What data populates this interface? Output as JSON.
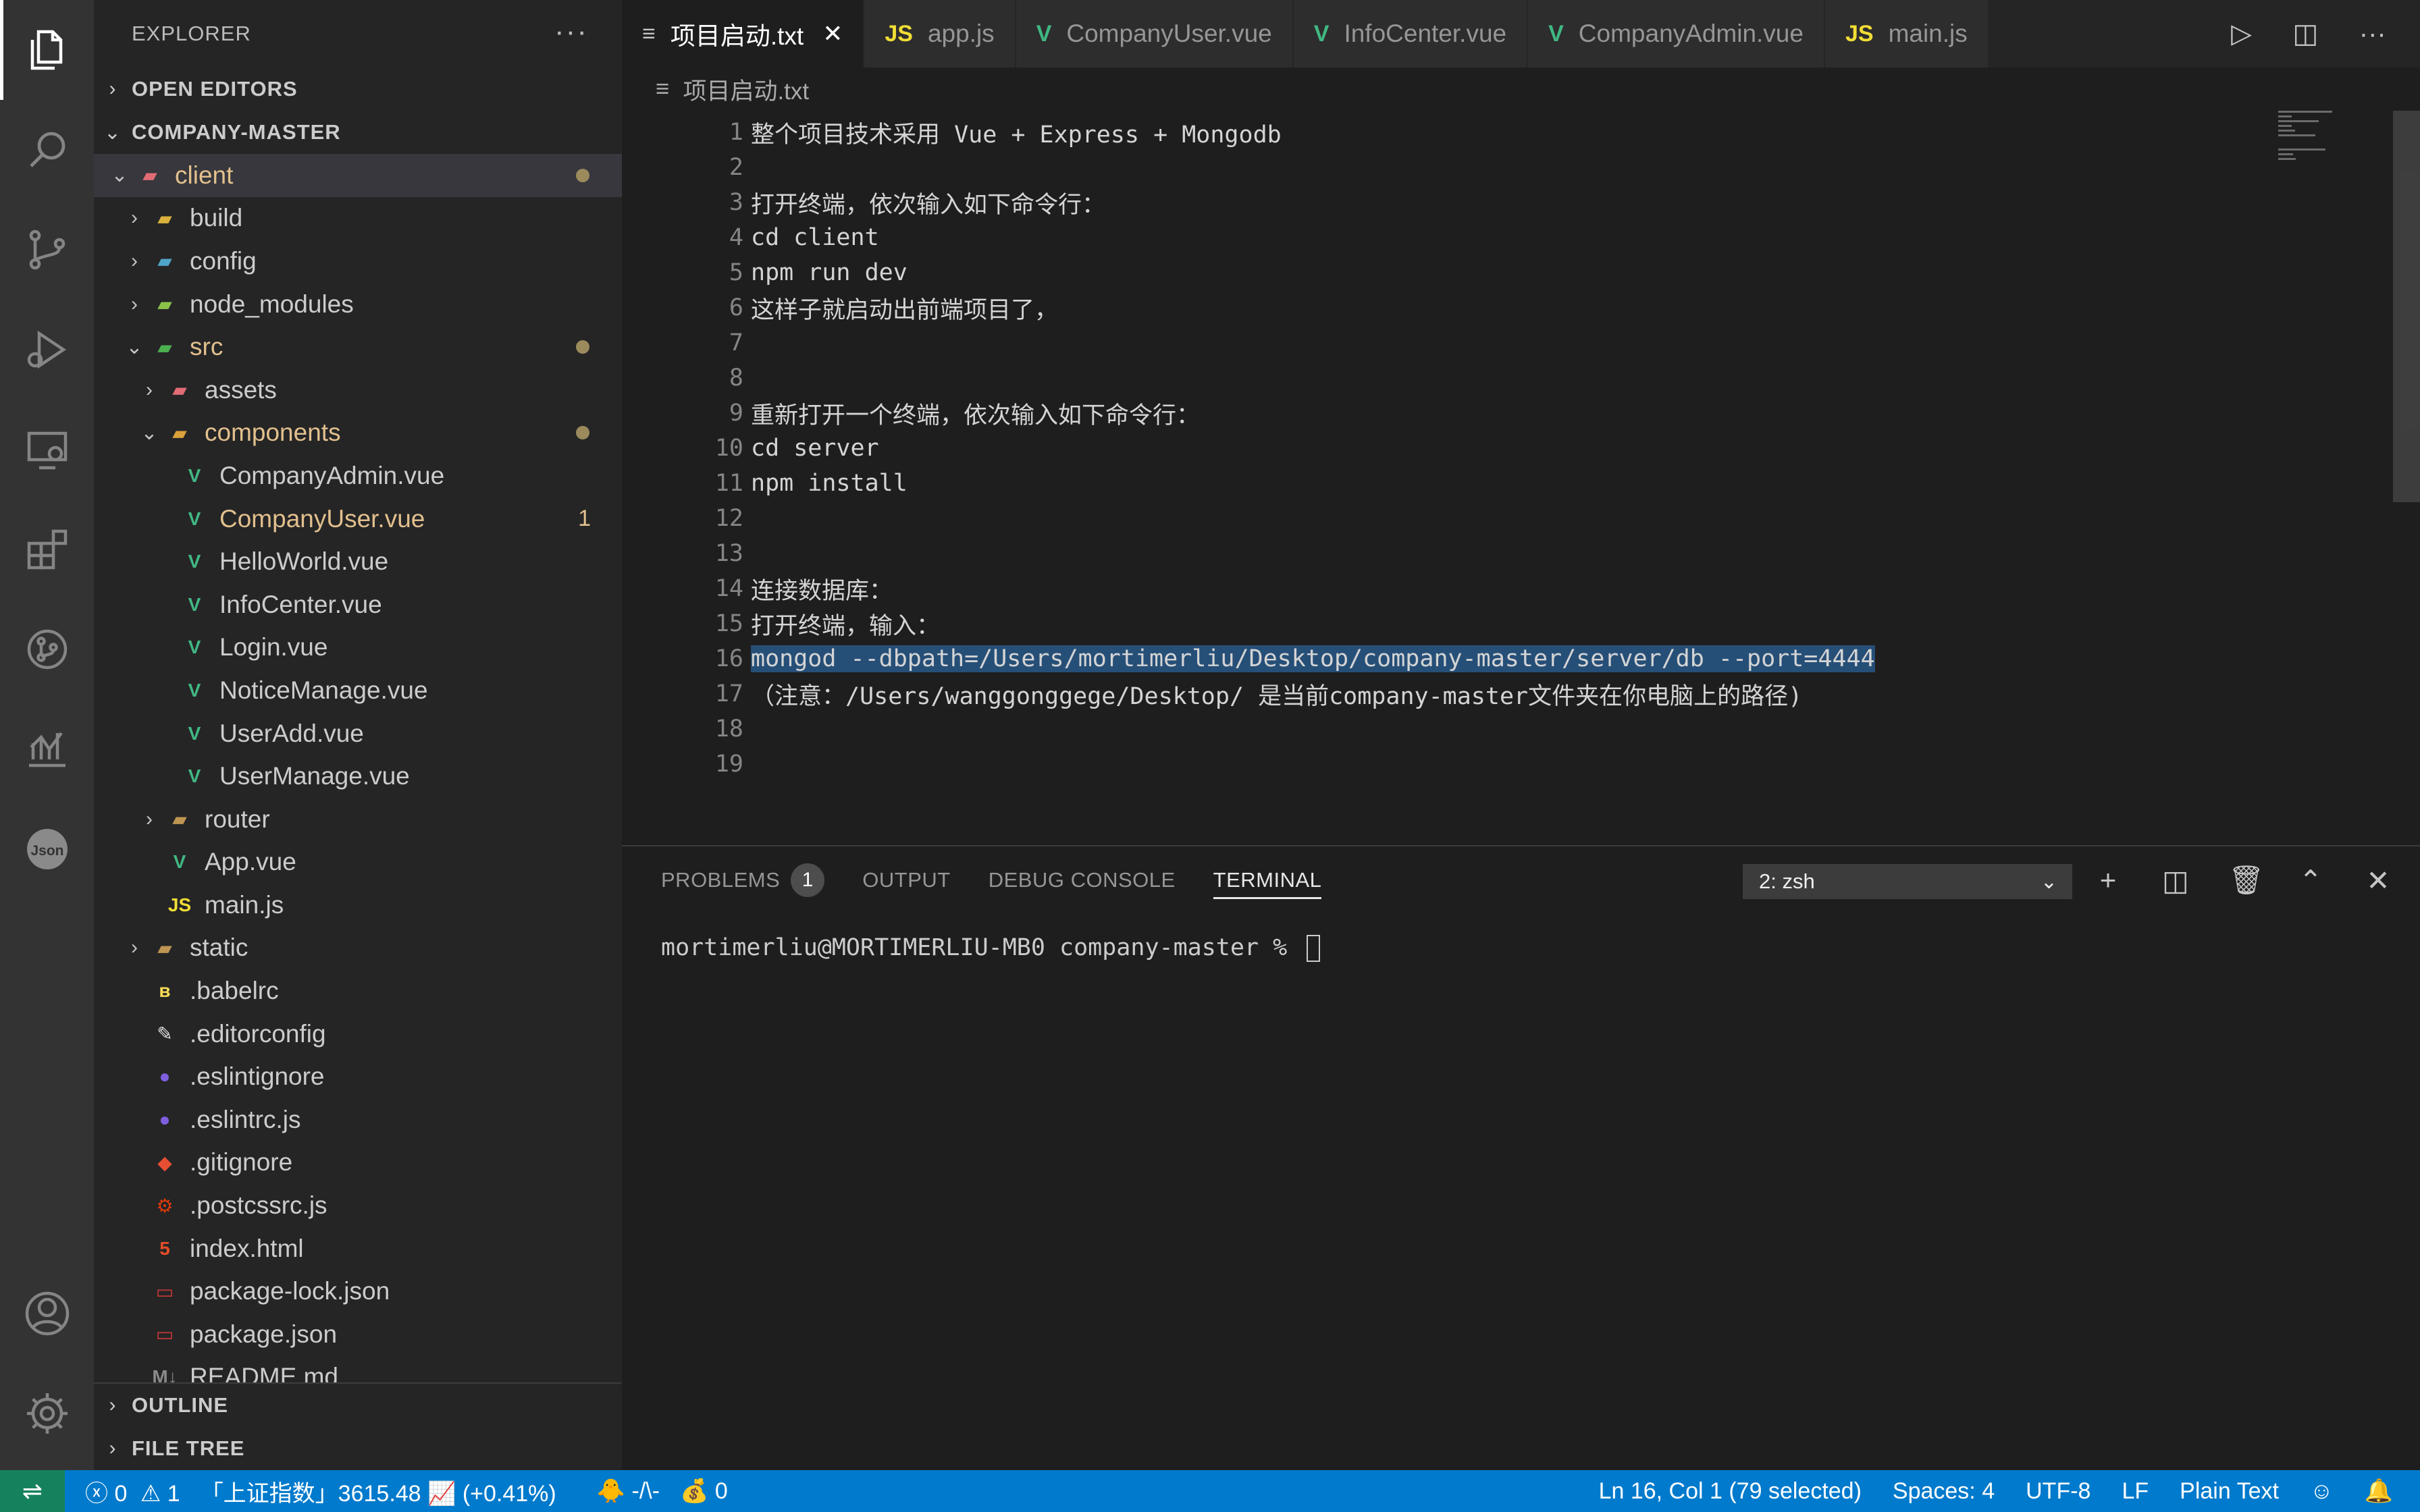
{
  "tabs": [
    {
      "label": "项目启动.txt",
      "icon": "≡",
      "active": true
    },
    {
      "label": "app.js",
      "icon": "JS"
    },
    {
      "label": "CompanyUser.vue",
      "icon": "V"
    },
    {
      "label": "InfoCenter.vue",
      "icon": "V"
    },
    {
      "label": "CompanyAdmin.vue",
      "icon": "V"
    },
    {
      "label": "main.js",
      "icon": "JS"
    }
  ],
  "sidebar": {
    "title": "EXPLORER",
    "open_editors": "OPEN EDITORS",
    "project": "COMPANY-MASTER",
    "outline": "OUTLINE",
    "file_tree": "FILE TREE",
    "items": [
      {
        "label": "client",
        "depth": 0,
        "arrow": "⌄",
        "icon": "folder-vue",
        "modified": true,
        "dot": true,
        "selected": true
      },
      {
        "label": "build",
        "depth": 1,
        "arrow": "›",
        "icon": "folder-build"
      },
      {
        "label": "config",
        "depth": 1,
        "arrow": "›",
        "icon": "folder-config"
      },
      {
        "label": "node_modules",
        "depth": 1,
        "arrow": "›",
        "icon": "folder-node"
      },
      {
        "label": "src",
        "depth": 1,
        "arrow": "⌄",
        "icon": "folder-src",
        "modified": true,
        "dot": true
      },
      {
        "label": "assets",
        "depth": 2,
        "arrow": "›",
        "icon": "folder-assets"
      },
      {
        "label": "components",
        "depth": 2,
        "arrow": "⌄",
        "icon": "folder-components",
        "modified": true,
        "dot": true
      },
      {
        "label": "CompanyAdmin.vue",
        "depth": 3,
        "icon": "vue"
      },
      {
        "label": "CompanyUser.vue",
        "depth": 3,
        "icon": "vue",
        "modified": true,
        "badge": "1"
      },
      {
        "label": "HelloWorld.vue",
        "depth": 3,
        "icon": "vue"
      },
      {
        "label": "InfoCenter.vue",
        "depth": 3,
        "icon": "vue"
      },
      {
        "label": "Login.vue",
        "depth": 3,
        "icon": "vue"
      },
      {
        "label": "NoticeManage.vue",
        "depth": 3,
        "icon": "vue"
      },
      {
        "label": "UserAdd.vue",
        "depth": 3,
        "icon": "vue"
      },
      {
        "label": "UserManage.vue",
        "depth": 3,
        "icon": "vue"
      },
      {
        "label": "router",
        "depth": 2,
        "arrow": "›",
        "icon": "folder"
      },
      {
        "label": "App.vue",
        "depth": 2,
        "icon": "vue"
      },
      {
        "label": "main.js",
        "depth": 2,
        "icon": "js"
      },
      {
        "label": "static",
        "depth": 1,
        "arrow": "›",
        "icon": "folder"
      },
      {
        "label": ".babelrc",
        "depth": 1,
        "icon": "babel"
      },
      {
        "label": ".editorconfig",
        "depth": 1,
        "icon": "editorconfig"
      },
      {
        "label": ".eslintignore",
        "depth": 1,
        "icon": "eslint"
      },
      {
        "label": ".eslintrc.js",
        "depth": 1,
        "icon": "eslint"
      },
      {
        "label": ".gitignore",
        "depth": 1,
        "icon": "git"
      },
      {
        "label": ".postcssrc.js",
        "depth": 1,
        "icon": "postcss"
      },
      {
        "label": "index.html",
        "depth": 1,
        "icon": "html"
      },
      {
        "label": "package-lock.json",
        "depth": 1,
        "icon": "npm"
      },
      {
        "label": "package.json",
        "depth": 1,
        "icon": "npm"
      },
      {
        "label": "README.md",
        "depth": 1,
        "icon": "markdown"
      }
    ]
  },
  "breadcrumb": "项目启动.txt",
  "editor": {
    "lines": [
      {
        "n": "1",
        "text": "整个项目技术采用 Vue + Express + Mongodb"
      },
      {
        "n": "2",
        "text": ""
      },
      {
        "n": "3",
        "text": "打开终端，依次输入如下命令行："
      },
      {
        "n": "4",
        "text": "cd client"
      },
      {
        "n": "5",
        "text": "npm run dev"
      },
      {
        "n": "6",
        "text": "这样子就启动出前端项目了，"
      },
      {
        "n": "7",
        "text": ""
      },
      {
        "n": "8",
        "text": ""
      },
      {
        "n": "9",
        "text": "重新打开一个终端，依次输入如下命令行："
      },
      {
        "n": "10",
        "text": "cd server"
      },
      {
        "n": "11",
        "text": "npm install"
      },
      {
        "n": "12",
        "text": ""
      },
      {
        "n": "13",
        "text": ""
      },
      {
        "n": "14",
        "text": "连接数据库："
      },
      {
        "n": "15",
        "text": "打开终端，输入："
      },
      {
        "n": "16",
        "text": "mongod --dbpath=/Users/mortimerliu/Desktop/company-master/server/db --port=4444",
        "selected": true
      },
      {
        "n": "17",
        "text": "（注意：/Users/wanggonggege/Desktop/ 是当前company-master文件夹在你电脑上的路径)"
      },
      {
        "n": "18",
        "text": ""
      },
      {
        "n": "19",
        "text": ""
      }
    ]
  },
  "panel": {
    "tabs": {
      "problems": "PROBLEMS",
      "problems_count": "1",
      "output": "OUTPUT",
      "debug": "DEBUG CONSOLE",
      "terminal": "TERMINAL"
    },
    "terminal_select": "2: zsh",
    "prompt": "mortimerliu@MORTIMERLIU-MB0 company-master % "
  },
  "status": {
    "errors": "0",
    "warnings": "1",
    "stock": "「上证指数」3615.48 📈 (+0.41%)",
    "ext1": "🐥 -/\\-",
    "ext2": "💰 0",
    "position": "Ln 16, Col 1 (79 selected)",
    "spaces": "Spaces: 4",
    "encoding": "UTF-8",
    "eol": "LF",
    "language": "Plain Text"
  },
  "colors": {
    "accent": "#007acc",
    "selection": "#264f78",
    "modified": "#e2c08d",
    "vue": "#41b883",
    "js": "#f1dd35"
  }
}
